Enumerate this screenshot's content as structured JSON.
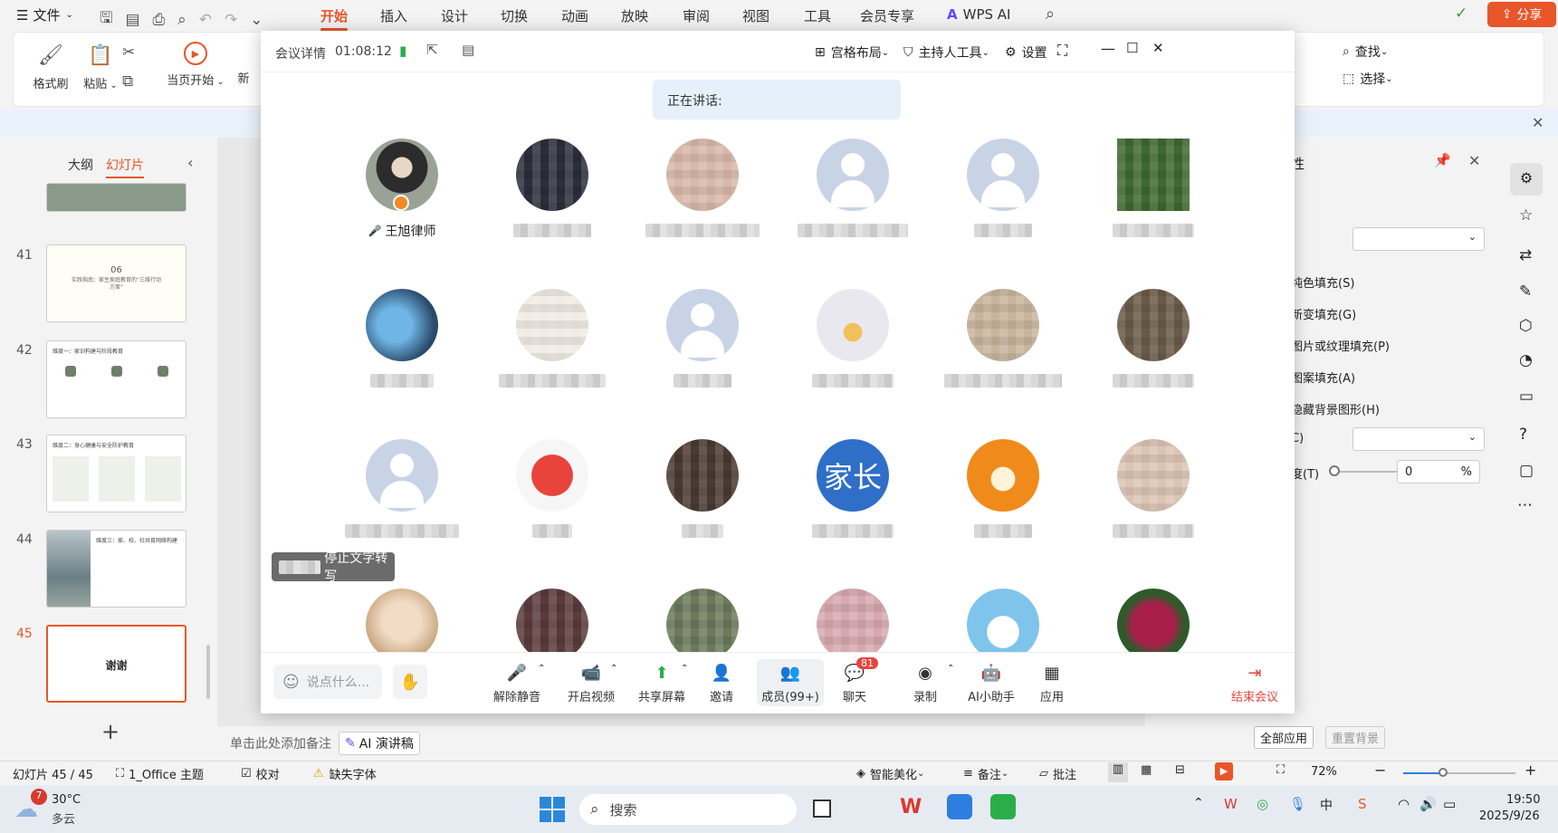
{
  "menubar": {
    "file": "文件",
    "tabs": [
      "开始",
      "插入",
      "设计",
      "切换",
      "动画",
      "放映",
      "审阅",
      "视图",
      "工具",
      "会员专享"
    ],
    "wps_ai": "WPS AI",
    "share": "分享"
  },
  "ribbon": {
    "format_painter": "格式刷",
    "paste": "粘贴",
    "from_current": "当页开始",
    "new": "新",
    "find": "查找",
    "select": "选择"
  },
  "left_panel": {
    "tab_outline": "大纲",
    "tab_slides": "幻灯片",
    "slides": [
      {
        "num": "41",
        "title": "06",
        "subtitle": "实践指南：家生家庭教育的“三维行动方案”"
      },
      {
        "num": "42",
        "title": "维度一：家训构建与阶段教育"
      },
      {
        "num": "43",
        "title": "维度二：身心健康与安全防护教育"
      },
      {
        "num": "44",
        "title": "维度三：家、校、社共育网络构建"
      },
      {
        "num": "45",
        "title": "谢谢"
      }
    ]
  },
  "notes": {
    "placeholder": "单击此处添加备注",
    "ai_script": "AI 演讲稿"
  },
  "props": {
    "title": "性",
    "items": [
      "纯色填充(S)",
      "新变填充(G)",
      "图片或纹理填充(P)",
      "图案填充(A)",
      "隐藏背景图形(H)"
    ],
    "c_label": "C)",
    "t_label": "度(T)",
    "percent_value": "0",
    "percent_unit": "%",
    "apply_all": "全部应用",
    "reset_bg": "重置背景"
  },
  "status": {
    "slide": "幻灯片 45 / 45",
    "theme": "1_Office 主题",
    "proof": "校对",
    "missing_font": "缺失字体",
    "beautify": "智能美化",
    "notes": "备注",
    "comment": "批注",
    "zoom": "72%"
  },
  "taskbar": {
    "weather_temp": "30°C",
    "weather_desc": "多云",
    "weather_badge": "7",
    "search": "搜索",
    "time": "19:50",
    "date": "2025/9/26"
  },
  "meeting": {
    "title": "会议详情",
    "timer": "01:08:12",
    "layout": "宫格布局",
    "host_tools": "主持人工具",
    "settings": "设置",
    "speaking": "正在讲话:",
    "host_name": "王旭律师",
    "parent_avatar": "家长",
    "transcript": "停止文字转写",
    "chat_placeholder": "说点什么...",
    "toolbar": {
      "unmute": "解除静音",
      "video": "开启视频",
      "share": "共享屏幕",
      "invite": "邀请",
      "members": "成员(99+)",
      "chat": "聊天",
      "chat_badge": "81",
      "record": "录制",
      "ai_assistant": "AI小助手",
      "apps": "应用",
      "end": "结束会议"
    }
  }
}
